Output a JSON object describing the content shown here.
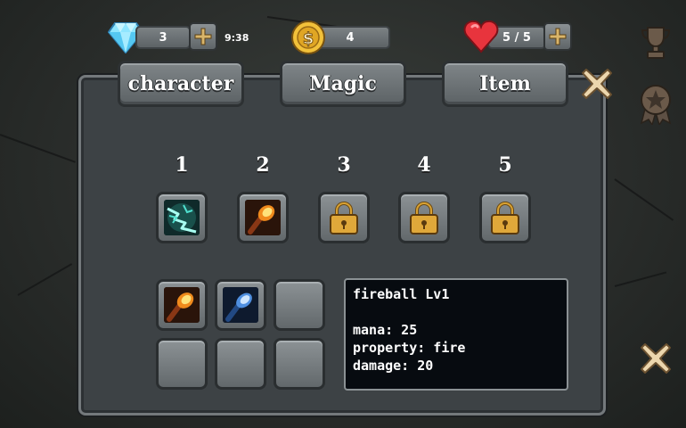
{
  "top_bar": {
    "gems": {
      "value": "3",
      "timer": "9:38"
    },
    "coins": {
      "value": "4"
    },
    "hearts": {
      "value": "5 / 5"
    }
  },
  "tabs": [
    {
      "label": "character"
    },
    {
      "label": "Magic"
    },
    {
      "label": "Item"
    }
  ],
  "equipped_slots": [
    {
      "number": "1",
      "content": "lightning-spell-icon",
      "locked": false
    },
    {
      "number": "2",
      "content": "fireball-spell-icon",
      "locked": false
    },
    {
      "number": "3",
      "content": "padlock-icon",
      "locked": true
    },
    {
      "number": "4",
      "content": "padlock-icon",
      "locked": true
    },
    {
      "number": "5",
      "content": "padlock-icon",
      "locked": true
    }
  ],
  "inventory": [
    {
      "content": "fireball-spell-icon"
    },
    {
      "content": "ice-spell-icon"
    },
    {
      "content": "empty"
    },
    {
      "content": "empty"
    },
    {
      "content": "empty"
    },
    {
      "content": "empty"
    }
  ],
  "info": {
    "title": "fireball Lv1",
    "mana": "mana: 25",
    "property": "property: fire",
    "damage": "damage: 20"
  },
  "colors": {
    "panel": "#3d4245",
    "button": "#6f7578",
    "info_bg": "#070b10",
    "accent_gold": "#d9a233",
    "close_tan": "#e9d3a8"
  }
}
